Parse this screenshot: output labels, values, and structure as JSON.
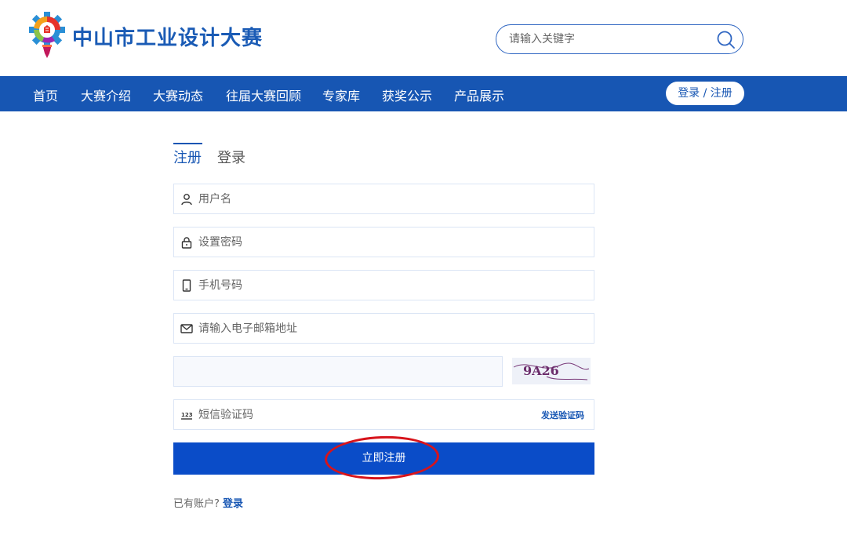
{
  "header": {
    "site_title": "中山市工业设计大赛",
    "search": {
      "placeholder": "请输入关键字",
      "value": ""
    }
  },
  "nav": {
    "items": [
      {
        "label": "首页"
      },
      {
        "label": "大赛介绍"
      },
      {
        "label": "大赛动态"
      },
      {
        "label": "往届大赛回顾"
      },
      {
        "label": "专家库"
      },
      {
        "label": "获奖公示"
      },
      {
        "label": "产品展示"
      }
    ],
    "login_register": "登录 / 注册"
  },
  "form": {
    "tabs": {
      "register": "注册",
      "login": "登录"
    },
    "fields": {
      "username": {
        "placeholder": "用户名",
        "icon": "user-icon"
      },
      "password": {
        "placeholder": "设置密码",
        "icon": "lock-icon"
      },
      "phone": {
        "placeholder": "手机号码",
        "icon": "phone-icon"
      },
      "email": {
        "placeholder": "请输入电子邮箱地址",
        "icon": "mail-icon"
      },
      "sms": {
        "placeholder": "短信验证码",
        "icon": "sms-code-icon"
      }
    },
    "captcha_text": "9A26",
    "send_code": "发送验证码",
    "submit": "立即注册",
    "has_account": "已有账户?",
    "login_link": "登录"
  },
  "colors": {
    "primary": "#1756b3",
    "submit": "#0a4cc8",
    "annotation": "#d7141b"
  }
}
